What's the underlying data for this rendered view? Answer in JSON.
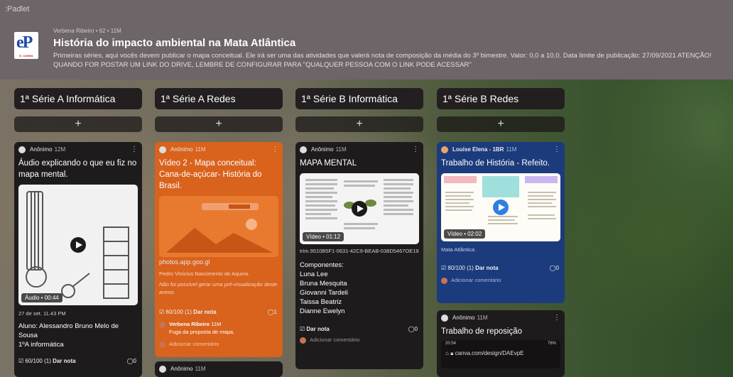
{
  "app": {
    "brand": ":Padlet"
  },
  "header": {
    "logo_text": "eP",
    "logo_sub": "E. CUNHA",
    "meta": "Verbena Ribeiro • 62 • 11M",
    "title": "História do impacto ambiental na Mata Atlântica",
    "description": "Primeiras séries, aqui vocês devem publicar o mapa conceitual. Ele irá ser uma das atividades que valerá nota de composição da média do 3º bimestre. Valor: 0,0 a 10,0. Data limite de publicação: 27/09/2021 ATENÇÃO! QUANDO FOR POSTAR UM LINK DO DRIVE, LEMBRE DE CONFIGURAR PARA \"QUALQUER PESSOA COM O LINK PODE ACESSAR\""
  },
  "add_label": "+",
  "columns": [
    {
      "title": "1ª Série A Informática"
    },
    {
      "title": "1ª Série A Redes"
    },
    {
      "title": "1ª Série B Informática"
    },
    {
      "title": "1ª Série B Redes"
    }
  ],
  "cards": {
    "c1": {
      "author": "Anônimo",
      "time": "12M",
      "title": "Áudio explicando o que eu fiz no mapa mental.",
      "badge": "Áudio • 00:44",
      "date": "27 de set. 11.43 PM",
      "body": "Aluno: Alessandro Bruno Melo de Sousa",
      "body2": "1ºA informática",
      "rating": "60/100 (1)",
      "rate_label": "Dar nota",
      "comments": "0"
    },
    "c2": {
      "author": "Anônimo",
      "time": "11M",
      "title": "Vídeo 2 - Mapa conceitual: Cana-de-açúcar- História do Brasil.",
      "link": "photos.app.goo.gl",
      "body": "Pedro Vinícius Nascimento de Aquino.",
      "note": "Não foi possível gerar uma pré-visualização deste anexo.",
      "rating": "60/100 (1)",
      "rate_label": "Dar nota",
      "comments": "1",
      "comment_author": "Verbena Ribeiro",
      "comment_time": "11M",
      "comment_text": "Fuga da proposta de mapa.",
      "add_comment": "Adicionar comentário"
    },
    "c3": {
      "author": "Anônimo",
      "time": "11M",
      "title": "MAPA MENTAL",
      "badge": "Vídeo • 01:12",
      "file": "trim.9510B5F1-0631-42C9-BEAB-038D5467OE19",
      "heading": "Componentes:",
      "names": [
        "Luna Lee",
        "Bruna Mesquita",
        "Giovanni Tardeli",
        "Taissa Beatriz",
        "Dianne Ewelyn"
      ],
      "rate_label": "Dar nota",
      "comments": "0",
      "add_comment": "Adicionar comentário"
    },
    "c4": {
      "author": "Louise Elena - 1BR",
      "time": "11M",
      "title": "Trabalho de História - Refeito.",
      "badge": "Vídeo • 02:02",
      "caption": "Mata Atlântica",
      "rating": "80/100 (1)",
      "rate_label": "Dar nota",
      "comments": "0",
      "add_comment": "Adicionar comentário",
      "thumb_labels": [
        "Cana-de-açúcar",
        "Pau-Brasil",
        "Aspectos",
        "Aspectos"
      ]
    },
    "c5": {
      "author": "Anônimo",
      "time": "11M",
      "title": "Trabalho de reposição",
      "status_time": "20:54",
      "status_right": "76%",
      "url": "canva.com/design/DAEvpE"
    },
    "c6": {
      "author": "Anônimo",
      "time": "11M"
    }
  },
  "colors": {
    "header_bg": "#6d6567",
    "card_dark": "#1e1b1c",
    "card_orange": "#d9621c",
    "card_blue": "#1c3b7c"
  }
}
